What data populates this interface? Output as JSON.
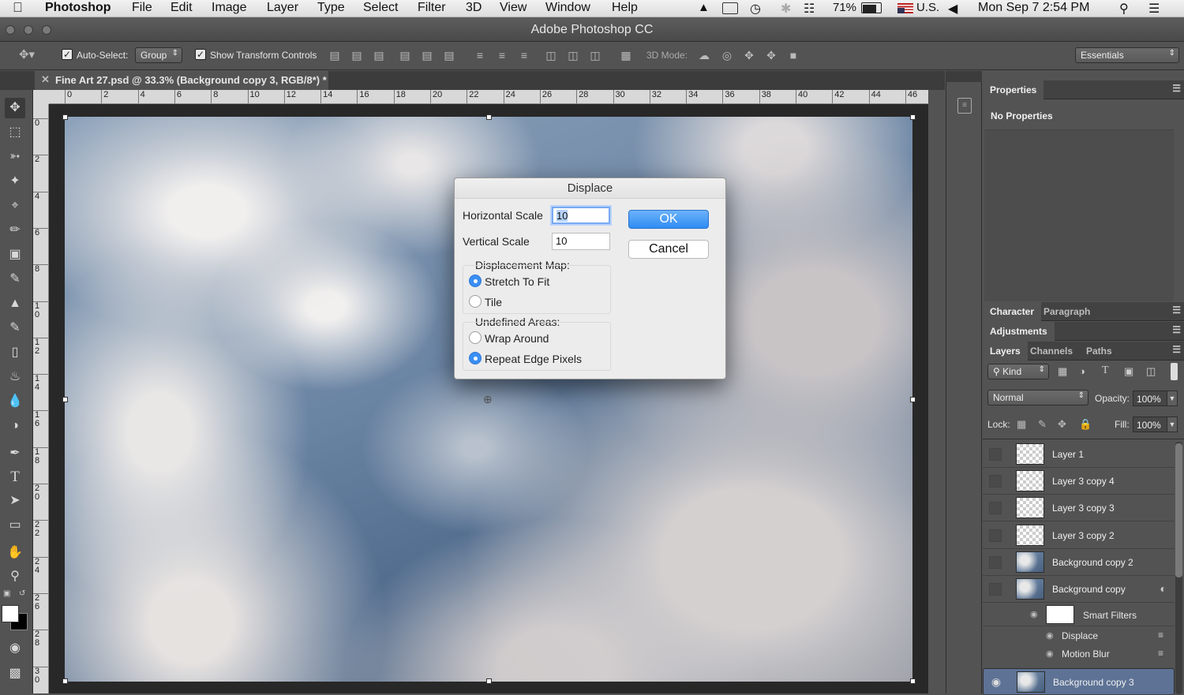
{
  "menubar": {
    "apple": "",
    "items": [
      "Photoshop",
      "File",
      "Edit",
      "Image",
      "Layer",
      "Type",
      "Select",
      "Filter",
      "3D",
      "View",
      "Window",
      "Help"
    ],
    "battery": "71%",
    "input_source": "U.S.",
    "clock": "Mon Sep 7  2:54 PM"
  },
  "window": {
    "title": "Adobe Photoshop CC"
  },
  "options": {
    "auto_select_label": "Auto-Select:",
    "auto_select_value": "Group",
    "show_transform_label": "Show Transform Controls",
    "mode_3d_label": "3D Mode:",
    "workspace": "Essentials"
  },
  "document": {
    "tab_title": "Fine Art 27.psd @ 33.3% (Background copy 3, RGB/8*) *",
    "h_ruler": [
      "0",
      "2",
      "4",
      "6",
      "8",
      "10",
      "12",
      "14",
      "16",
      "18",
      "20",
      "22",
      "24",
      "26",
      "28",
      "30",
      "32",
      "34",
      "36",
      "38",
      "40",
      "42",
      "44",
      "46"
    ],
    "v_ruler": [
      "0",
      "2",
      "4",
      "6",
      "8",
      "1\n0",
      "1\n2",
      "1\n4",
      "1\n6",
      "1\n8",
      "2\n0",
      "2\n2",
      "2\n4",
      "2\n6",
      "2\n8",
      "3\n0"
    ]
  },
  "dialog": {
    "title": "Displace",
    "horizontal_label": "Horizontal Scale",
    "horizontal_value": "10",
    "vertical_label": "Vertical Scale",
    "vertical_value": "10",
    "map_group_label": "Displacement Map:",
    "map_options": [
      {
        "label": "Stretch To Fit",
        "selected": true
      },
      {
        "label": "Tile",
        "selected": false
      }
    ],
    "undef_group_label": "Undefined Areas:",
    "undef_options": [
      {
        "label": "Wrap Around",
        "selected": false
      },
      {
        "label": "Repeat Edge Pixels",
        "selected": true
      }
    ],
    "ok_label": "OK",
    "cancel_label": "Cancel"
  },
  "panels": {
    "properties_tab": "Properties",
    "properties_message": "No Properties",
    "character_tab": "Character",
    "paragraph_tab": "Paragraph",
    "adjustments_tab": "Adjustments",
    "layers_tab": "Layers",
    "channels_tab": "Channels",
    "paths_tab": "Paths",
    "kind_filter": "Kind",
    "blend_mode": "Normal",
    "opacity_label": "Opacity:",
    "opacity_value": "100%",
    "lock_label": "Lock:",
    "fill_label": "Fill:",
    "fill_value": "100%"
  },
  "layers": [
    {
      "name": "Layer 1",
      "thumb": "transparent",
      "visible": false,
      "selected": false
    },
    {
      "name": "Layer 3 copy 4",
      "thumb": "transparent",
      "visible": false,
      "selected": false
    },
    {
      "name": "Layer 3 copy 3",
      "thumb": "transparent",
      "visible": false,
      "selected": false
    },
    {
      "name": "Layer 3 copy 2",
      "thumb": "transparent",
      "visible": false,
      "selected": false
    },
    {
      "name": "Background copy 2",
      "thumb": "sky",
      "visible": false,
      "selected": false
    },
    {
      "name": "Background copy",
      "thumb": "sky",
      "visible": false,
      "selected": false
    }
  ],
  "smart_filters": {
    "label": "Smart Filters",
    "filters": [
      "Displace",
      "Motion Blur"
    ]
  },
  "selected_layer": "Background copy 3",
  "colors": {
    "accent": "#3a8ff4",
    "selection": "#5d7295",
    "panel_bg": "#535353"
  }
}
